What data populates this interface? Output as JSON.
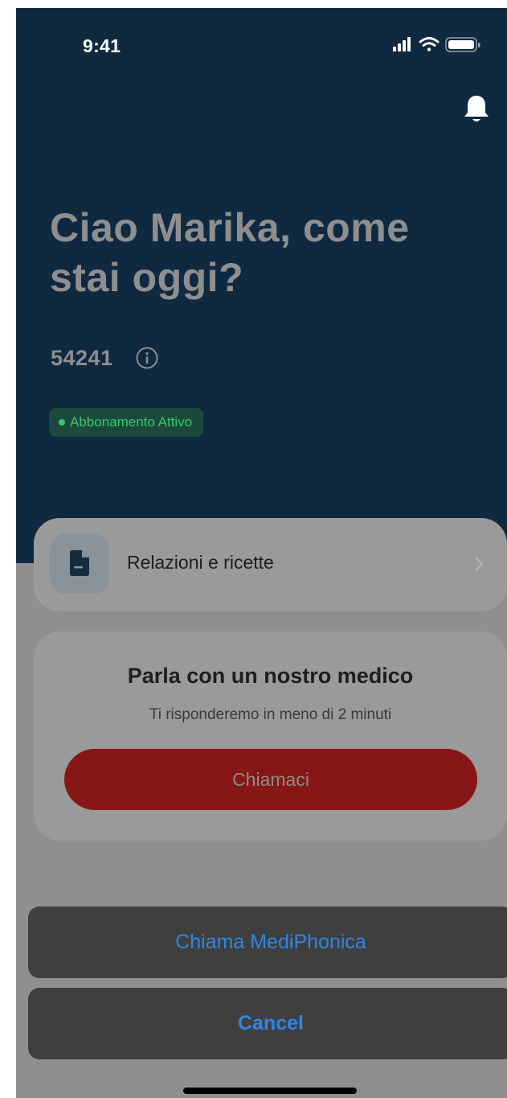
{
  "status_bar": {
    "time": "9:41",
    "icons": [
      "signal-icon",
      "wifi-icon",
      "battery-icon"
    ]
  },
  "header": {
    "notification_icon": "bell-icon",
    "greeting": "Ciao Marika, come stai oggi?",
    "user_id": "54241",
    "info_icon": "info-icon",
    "subscription_badge": "Abbonamento Attivo"
  },
  "reports_card": {
    "icon": "document-icon",
    "label": "Relazioni e ricette",
    "chevron": "chevron-right-icon"
  },
  "doctor_card": {
    "title": "Parla con un nostro medico",
    "subtitle": "Ti risponderemo in meno di 2 minuti",
    "button_label": "Chiamaci"
  },
  "action_sheet": {
    "call_label": "Chiama MediPhonica",
    "cancel_label": "Cancel"
  },
  "colors": {
    "header_bg": "#0f2941",
    "overlay": "#8f8f8f",
    "badge_green": "#36c86d",
    "call_red": "#871616",
    "ios_blue": "#2d86e6"
  }
}
